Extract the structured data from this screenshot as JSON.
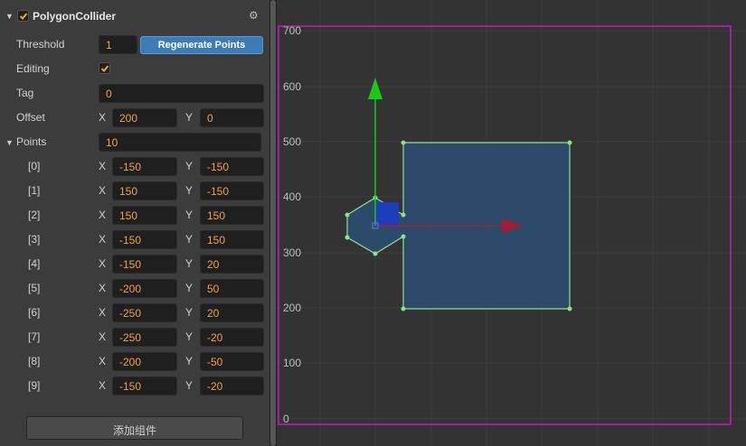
{
  "component": {
    "title": "PolygonCollider",
    "enabled": true,
    "gear_icon": "gear-icon"
  },
  "threshold": {
    "label": "Threshold",
    "value": "1"
  },
  "regenerate_button": "Regenerate Points",
  "editing": {
    "label": "Editing",
    "checked": true
  },
  "tag": {
    "label": "Tag",
    "value": "0"
  },
  "offset": {
    "label": "Offset",
    "x_axis": "X",
    "x": "200",
    "y_axis": "Y",
    "y": "0"
  },
  "points": {
    "label": "Points",
    "count": "10",
    "items": [
      {
        "index": "[0]",
        "x": "-150",
        "y": "-150"
      },
      {
        "index": "[1]",
        "x": "150",
        "y": "-150"
      },
      {
        "index": "[2]",
        "x": "150",
        "y": "150"
      },
      {
        "index": "[3]",
        "x": "-150",
        "y": "150"
      },
      {
        "index": "[4]",
        "x": "-150",
        "y": "20"
      },
      {
        "index": "[5]",
        "x": "-200",
        "y": "50"
      },
      {
        "index": "[6]",
        "x": "-250",
        "y": "20"
      },
      {
        "index": "[7]",
        "x": "-250",
        "y": "-20"
      },
      {
        "index": "[8]",
        "x": "-200",
        "y": "-50"
      },
      {
        "index": "[9]",
        "x": "-150",
        "y": "-20"
      }
    ]
  },
  "add_component_button": "添加组件",
  "scene": {
    "y_axis_labels": [
      "700",
      "600",
      "500",
      "400",
      "300",
      "200",
      "100",
      "0"
    ],
    "colors": {
      "canvas_border": "#a020a0",
      "collider_outline": "#8fe08f",
      "collider_fill": "#2c4d6e",
      "y_gizmo": "#19c819",
      "x_gizmo": "#a51c37",
      "pivot": "#3a78d8"
    }
  }
}
